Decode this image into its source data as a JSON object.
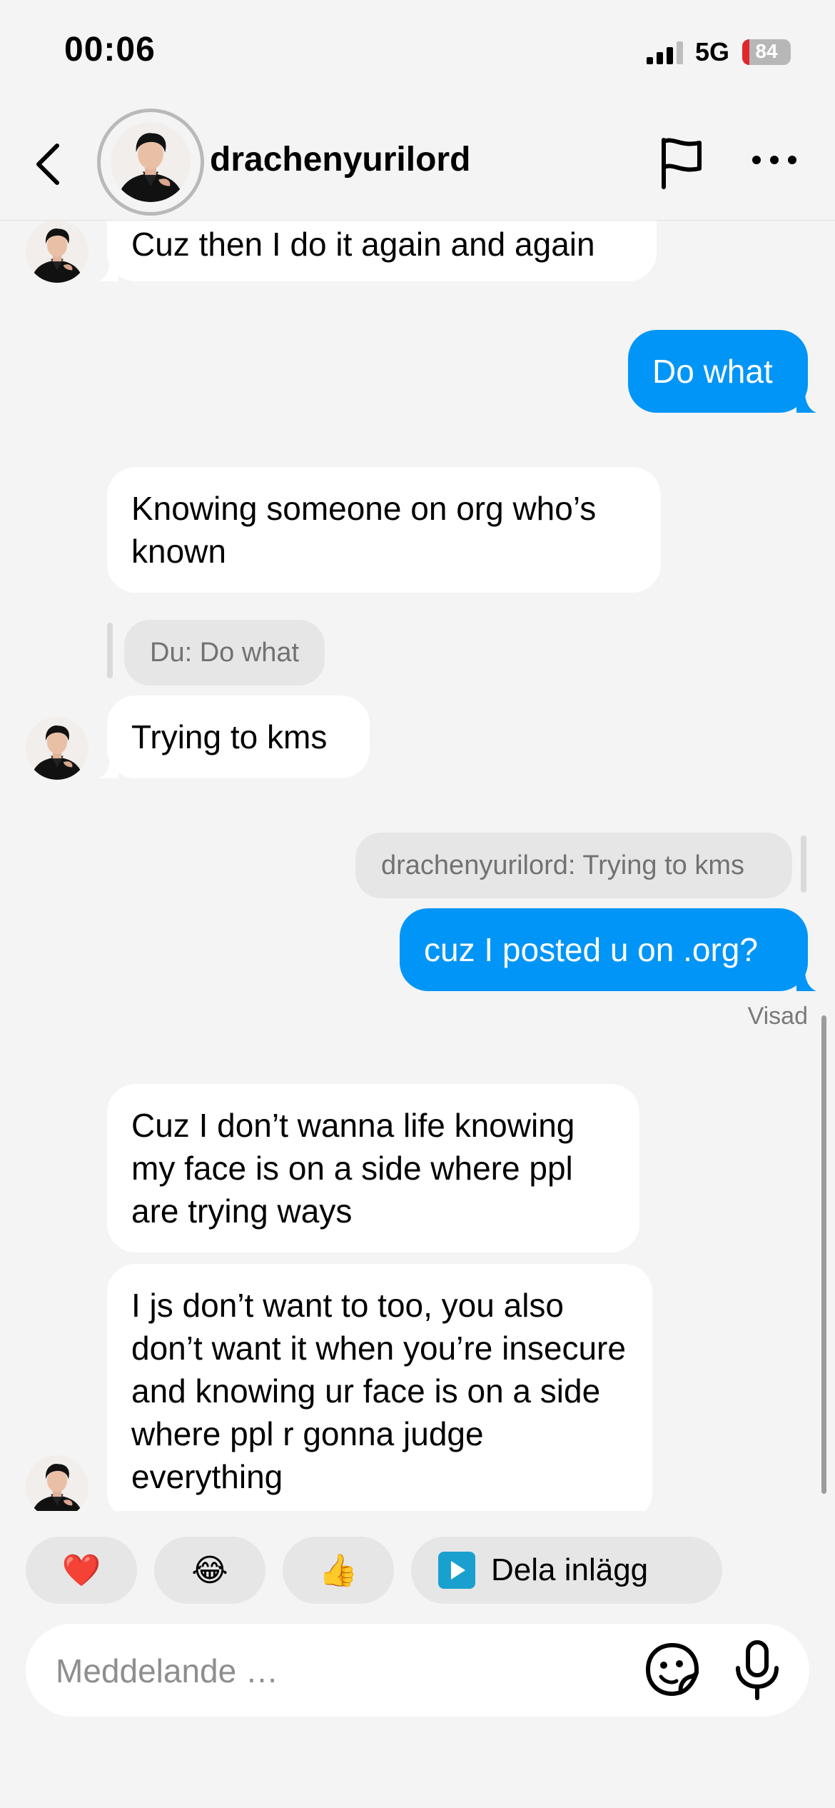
{
  "status_bar": {
    "time": "00:06",
    "network": "5G",
    "battery": "84"
  },
  "header": {
    "username": "drachenyurilord",
    "icons": [
      "back-icon",
      "flag-icon",
      "more-icon"
    ]
  },
  "messages": {
    "m0": "Cuz then I do it again and again",
    "m1": "Do what",
    "m2": "Knowing someone on org who’s known",
    "m3_reply": "Du: Do what",
    "m3": "Trying to kms",
    "m4_reply": "drachenyurilord: Trying to kms",
    "m4": "cuz I posted u on .org?",
    "m4_status": "Visad",
    "m5": "Cuz I don’t wanna life knowing my face is on a side where ppl are trying ways",
    "m6": "I js don’t want to too, you also don’t want it when you’re insecure and knowing ur face is on a side where ppl r gonna judge everything"
  },
  "quick_reactions": {
    "r1": "❤️",
    "r2": "😂",
    "r3": "👍",
    "share_label": "Dela inlägg"
  },
  "composer": {
    "placeholder": "Meddelande …"
  },
  "colors": {
    "outgoing": "#0095f6",
    "incoming": "#ffffff",
    "background": "#f4f4f4"
  }
}
